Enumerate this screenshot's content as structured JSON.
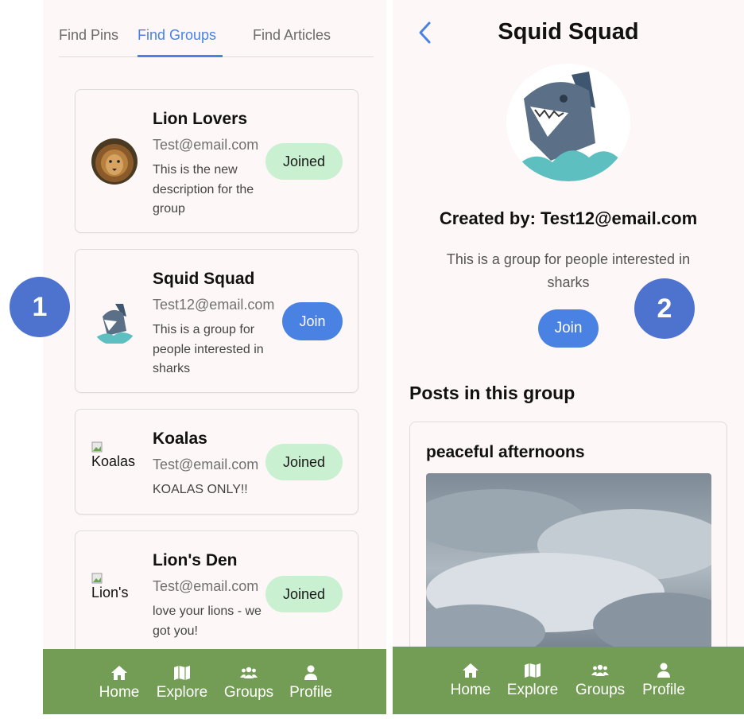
{
  "colors": {
    "accent": "#4a82e4",
    "joined_bg": "#c9f0d1",
    "nav_bg": "#739d55",
    "badge_bg": "#4d73cf",
    "page_bg": "#fdf8f7"
  },
  "left": {
    "tabs": [
      {
        "label": "Find Pins"
      },
      {
        "label": "Find Groups",
        "active": true
      },
      {
        "label": "Find Articles"
      }
    ],
    "groups": [
      {
        "name": "Lion Lovers",
        "email": "Test@email.com",
        "description": "This is the new description for the group",
        "status": "Joined",
        "avatar": "lion-photo"
      },
      {
        "name": "Squid Squad",
        "email": "Test12@email.com",
        "description": "This is a group for people interested in sharks",
        "status": "Join",
        "avatar": "shark-illustration"
      },
      {
        "name": "Koalas",
        "email": "Test@email.com",
        "description": "KOALAS ONLY!!",
        "status": "Joined",
        "avatar_alt": "Koalas"
      },
      {
        "name": "Lion's Den",
        "email": "Test@email.com",
        "description": "love your lions - we got you!",
        "status": "Joined",
        "avatar_alt": "Lion's"
      }
    ]
  },
  "nav": {
    "items": [
      {
        "label": "Home",
        "icon": "home-icon"
      },
      {
        "label": "Explore",
        "icon": "map-icon"
      },
      {
        "label": "Groups",
        "icon": "users-icon"
      },
      {
        "label": "Profile",
        "icon": "user-icon"
      }
    ]
  },
  "right": {
    "title": "Squid Squad",
    "created_by": "Created by: Test12@email.com",
    "description": "This is a group for people interested in sharks",
    "join_label": "Join",
    "posts_heading": "Posts in this group",
    "post": {
      "title": "peaceful afternoons",
      "image": "cloudy-sky-photo"
    }
  },
  "badges": [
    "1",
    "2"
  ]
}
